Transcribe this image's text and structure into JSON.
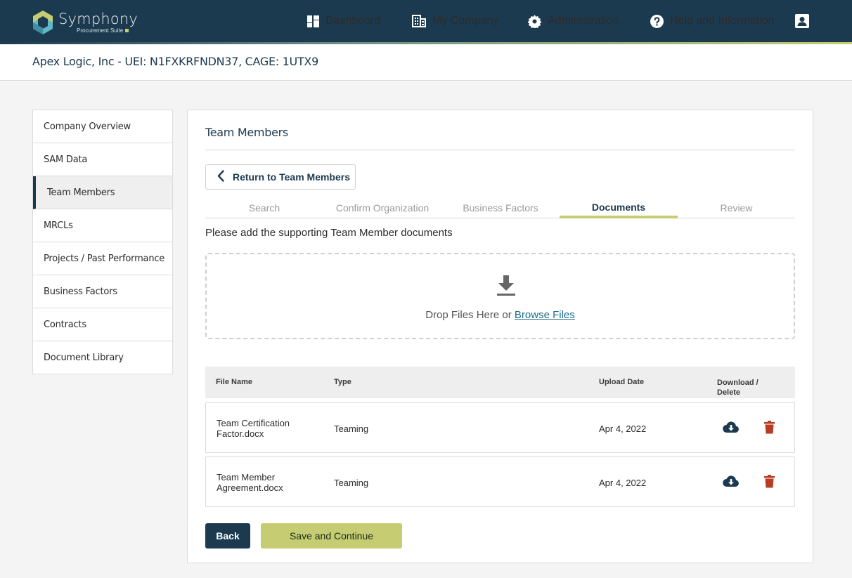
{
  "brand": {
    "name": "Symphony",
    "subtitle": "Procurement Suite",
    "colors": {
      "navy": "#1c3a4f",
      "accent": "#c5cc72",
      "danger": "#c0392b",
      "link": "#1b6d8a"
    }
  },
  "nav": {
    "items": [
      {
        "label": "Dashboard",
        "icon": "dashboard-icon"
      },
      {
        "label": "My Company",
        "icon": "building-icon"
      },
      {
        "label": "Administration",
        "icon": "gear-icon"
      },
      {
        "label": "Help and Information",
        "icon": "help-icon"
      }
    ],
    "profile_icon": "user-profile-icon"
  },
  "company": {
    "title": "Apex Logic, Inc - UEI: N1FXKRFNDN37, CAGE: 1UTX9"
  },
  "sidebar": {
    "items": [
      {
        "label": "Company Overview"
      },
      {
        "label": "SAM Data"
      },
      {
        "label": "Team Members",
        "active": true
      },
      {
        "label": "MRCLs"
      },
      {
        "label": "Projects / Past Performance"
      },
      {
        "label": "Business Factors"
      },
      {
        "label": "Contracts"
      },
      {
        "label": "Document Library"
      }
    ]
  },
  "main": {
    "title": "Team Members",
    "return_label": "Return to Team Members",
    "tabs": [
      {
        "label": "Search"
      },
      {
        "label": "Confirm Organization"
      },
      {
        "label": "Business Factors"
      },
      {
        "label": "Documents",
        "active": true
      },
      {
        "label": "Review"
      }
    ],
    "instruction": "Please add the supporting Team Member documents",
    "dropzone": {
      "text": "Drop Files Here or",
      "link": "Browse Files",
      "icon": "download-icon"
    },
    "table": {
      "headers": {
        "file_name": "File Name",
        "type": "Type",
        "upload_date": "Upload Date",
        "actions_line1": "Download /",
        "actions_line2": "Delete"
      },
      "rows": [
        {
          "file_line1": "Team Certification",
          "file_line2": "Factor.docx",
          "type": "Teaming",
          "date": "Apr 4, 2022"
        },
        {
          "file_line1": "Team Member",
          "file_line2": "Agreement.docx",
          "type": "Teaming",
          "date": "Apr 4, 2022"
        }
      ]
    },
    "buttons": {
      "back": "Back",
      "save": "Save and Continue"
    }
  }
}
